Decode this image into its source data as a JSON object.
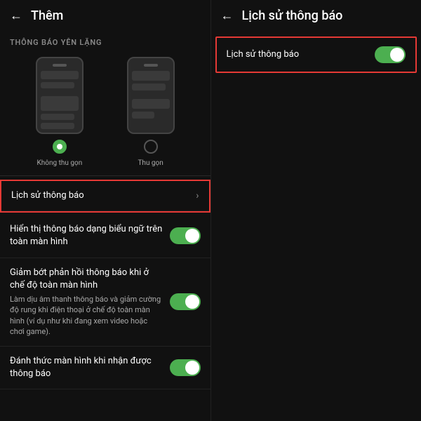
{
  "left_panel": {
    "header": {
      "back_label": "←",
      "title": "Thêm"
    },
    "section_label": "THÔNG BÁO YÊN LẶNG",
    "phone_options": [
      {
        "label": "Không thu gọn",
        "active": true
      },
      {
        "label": "Thu gọn",
        "active": false
      }
    ],
    "menu_items": [
      {
        "id": "lich-su",
        "text": "Lịch sử thông báo",
        "sub": "",
        "has_chevron": true,
        "has_toggle": false,
        "highlighted": true
      },
      {
        "id": "hien-thi",
        "text": "Hiển thị thông báo dạng biểu ngữ trên toàn màn hình",
        "sub": "",
        "has_chevron": false,
        "has_toggle": true,
        "toggle_on": true,
        "highlighted": false
      },
      {
        "id": "giam-bot",
        "text": "Giảm bớt phản hồi thông báo khi ở chế độ toàn màn hình",
        "sub": "Làm dịu âm thanh thông báo và giảm cường độ rung khi điện thoại ở chế độ toàn màn hình (ví dụ như khi đang xem video hoặc chơi game).",
        "has_chevron": false,
        "has_toggle": true,
        "toggle_on": true,
        "highlighted": false
      },
      {
        "id": "danh-thuc",
        "text": "Đánh thức màn hình khi nhận được thông báo",
        "sub": "",
        "has_chevron": false,
        "has_toggle": true,
        "toggle_on": true,
        "highlighted": false
      }
    ]
  },
  "right_panel": {
    "header": {
      "back_label": "←",
      "title": "Lịch sử thông báo"
    },
    "menu_items": [
      {
        "id": "lich-su-right",
        "text": "Lịch sử thông báo",
        "has_toggle": true,
        "toggle_on": true,
        "highlighted": true
      }
    ]
  },
  "icons": {
    "back": "←",
    "chevron": "›"
  }
}
